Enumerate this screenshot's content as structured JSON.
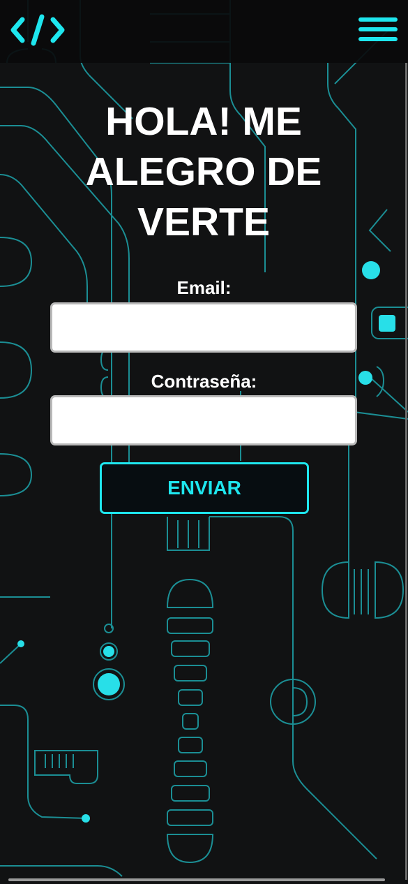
{
  "colors": {
    "accent": "#1ee6ee",
    "background": "#111213",
    "text": "#ffffff"
  },
  "header": {
    "logo_icon": "code-brackets-icon",
    "menu_icon": "hamburger-menu-icon"
  },
  "login": {
    "title": "HOLA! ME ALEGRO DE VERTE",
    "email_label": "Email:",
    "email_value": "",
    "password_label": "Contraseña:",
    "password_value": "",
    "submit_label": "ENVIAR"
  }
}
